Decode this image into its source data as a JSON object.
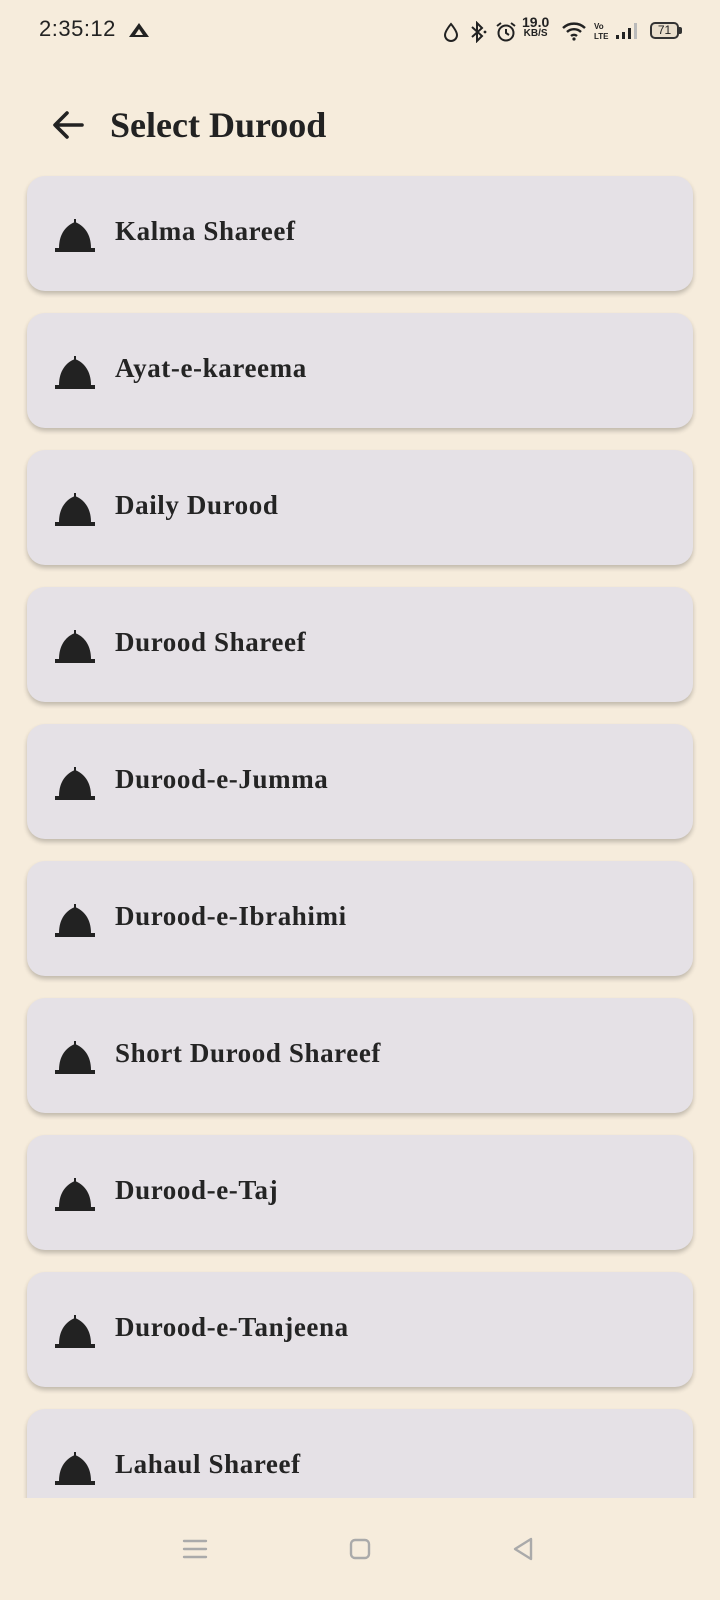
{
  "status_bar": {
    "time": "2:35:12",
    "net_speed_value": "19.0",
    "net_speed_unit": "KB/S",
    "battery_level": "71",
    "icons": [
      "delta-icon",
      "drop-icon",
      "bluetooth-icon",
      "alarm-icon",
      "wifi-icon",
      "volte-icon",
      "signal-icon",
      "battery-icon"
    ]
  },
  "app_bar": {
    "title": "Select Durood",
    "back_icon": "arrow-left-icon"
  },
  "list": {
    "item_icon": "dome-icon",
    "items": [
      {
        "label": "Kalma Shareef"
      },
      {
        "label": "Ayat-e-kareema"
      },
      {
        "label": "Daily Durood"
      },
      {
        "label": "Durood Shareef"
      },
      {
        "label": "Durood-e-Jumma"
      },
      {
        "label": "Durood-e-Ibrahimi"
      },
      {
        "label": "Short Durood Shareef"
      },
      {
        "label": "Durood-e-Taj"
      },
      {
        "label": "Durood-e-Tanjeena"
      },
      {
        "label": "Lahaul Shareef"
      }
    ]
  },
  "nav_bar": {
    "buttons": [
      "menu-icon",
      "home-icon",
      "back-triangle-icon"
    ]
  },
  "colors": {
    "background": "#f6ecdc",
    "card": "#e5e1e6",
    "text": "#222222"
  }
}
